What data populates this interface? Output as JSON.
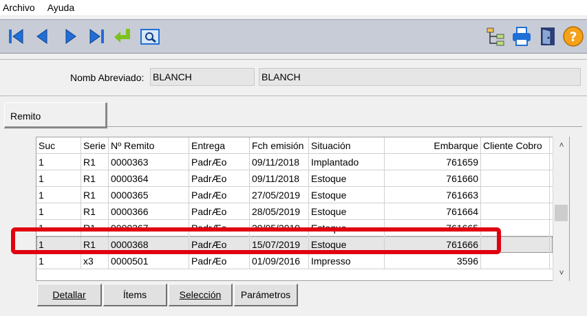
{
  "menu": {
    "items": [
      "Archivo",
      "Ayuda"
    ]
  },
  "toolbar": {
    "left_icons": [
      "first-record-icon",
      "previous-record-icon",
      "next-record-icon",
      "last-record-icon",
      "return-icon",
      "preview-icon"
    ],
    "right_icons": [
      "tree-icon",
      "printer-icon",
      "exit-door-icon",
      "help-icon"
    ]
  },
  "filter": {
    "label": "Nomb Abreviado:",
    "value1": "BLANCH",
    "value2": "BLANCH"
  },
  "tab": {
    "label": "Remito"
  },
  "table": {
    "columns": [
      "Suc",
      "Serie",
      "Nº Remito",
      "Entrega",
      "Fch emisión",
      "Situación",
      "Embarque",
      "Cliente Cobro"
    ],
    "rows": [
      [
        "1",
        "R1",
        "0000363",
        "PadrÆo",
        "09/11/2018",
        "Implantado",
        "761659",
        ""
      ],
      [
        "1",
        "R1",
        "0000364",
        "PadrÆo",
        "09/11/2018",
        "Estoque",
        "761660",
        ""
      ],
      [
        "1",
        "R1",
        "0000365",
        "PadrÆo",
        "27/05/2019",
        "Estoque",
        "761663",
        ""
      ],
      [
        "1",
        "R1",
        "0000366",
        "PadrÆo",
        "28/05/2019",
        "Estoque",
        "761664",
        ""
      ],
      [
        "1",
        "R1",
        "0000367",
        "PadrÆo",
        "29/05/2019",
        "Estoque",
        "761665",
        ""
      ],
      [
        "1",
        "R1",
        "0000368",
        "PadrÆo",
        "15/07/2019",
        "Estoque",
        "761666",
        ""
      ],
      [
        "1",
        "x3",
        "0000501",
        "PadrÆo",
        "01/09/2016",
        "Impresso",
        "3596",
        ""
      ]
    ],
    "selected_row": 5
  },
  "buttons": {
    "detallar": "Detallar",
    "items": "Ítems",
    "seleccion": "Selección",
    "parametros": "Parámetros"
  },
  "colors": {
    "highlight": "#e0000f",
    "toolbar_bg": "#c8ccd6",
    "icon_blue": "#1f6fd6",
    "icon_green": "#7cc21c"
  }
}
